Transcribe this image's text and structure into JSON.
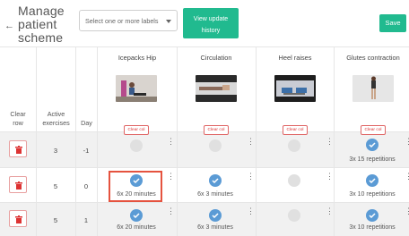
{
  "header": {
    "back_icon": "arrow-left-icon",
    "title": "Manage patient scheme",
    "title_lines": [
      "Manage",
      "patient",
      "scheme"
    ],
    "labels_placeholder": "Select one or more labels",
    "view_history_label_1": "View update",
    "view_history_label_2": "history",
    "save_label": "Save"
  },
  "colors": {
    "accent": "#21ba8f",
    "check": "#5b9bd5",
    "danger": "#d33333",
    "highlight": "#e5533f"
  },
  "columns": {
    "clear_row": [
      "Clear",
      "row"
    ],
    "active": [
      "Active",
      "exercises"
    ],
    "day": "Day",
    "clear_col_label": "Clear col"
  },
  "exercises": [
    {
      "name": "Icepacks Hip"
    },
    {
      "name": "Circulation"
    },
    {
      "name": "Heel raises"
    },
    {
      "name": "Glutes contraction"
    }
  ],
  "rows": [
    {
      "active": "3",
      "day": "-1",
      "cells": [
        {
          "checked": false,
          "dose": ""
        },
        {
          "checked": false,
          "dose": ""
        },
        {
          "checked": false,
          "dose": ""
        },
        {
          "checked": true,
          "dose": "3x 15 repetitions"
        }
      ]
    },
    {
      "active": "5",
      "day": "0",
      "cells": [
        {
          "checked": true,
          "dose": "6x 20 minutes"
        },
        {
          "checked": true,
          "dose": "6x 3 minutes"
        },
        {
          "checked": false,
          "dose": ""
        },
        {
          "checked": true,
          "dose": "3x 10 repetitions"
        }
      ]
    },
    {
      "active": "5",
      "day": "1",
      "cells": [
        {
          "checked": true,
          "dose": "6x 20 minutes"
        },
        {
          "checked": true,
          "dose": "6x 3 minutes"
        },
        {
          "checked": false,
          "dose": ""
        },
        {
          "checked": true,
          "dose": "3x 10 repetitions"
        }
      ]
    }
  ]
}
